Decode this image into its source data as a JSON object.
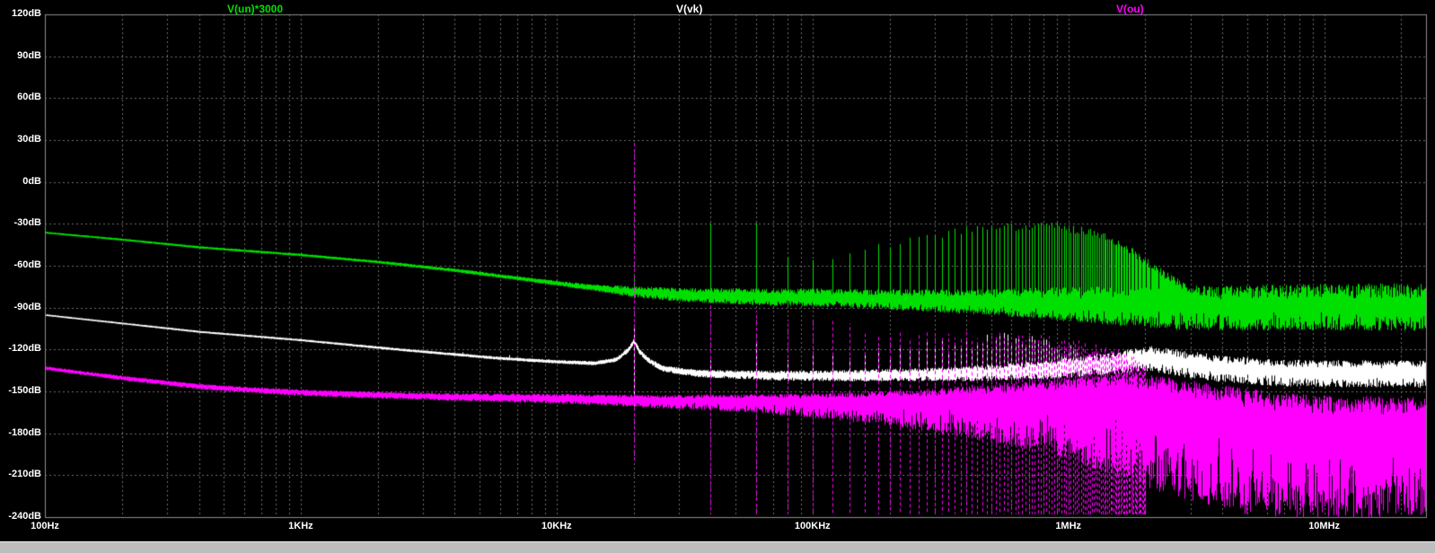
{
  "window": {
    "background": "#000000",
    "plot_border_color": "#8c8c8c",
    "grid_color": "#6f6f6f",
    "axis_text_color": "#ffffff",
    "statusbar_color": "#bdbdbd"
  },
  "chart_data": {
    "type": "line",
    "title": "",
    "grid": true,
    "legend_position": "top",
    "x_axis": {
      "scale": "log",
      "min_hz": 100,
      "max_hz": 25000000,
      "ticks": [
        "100Hz",
        "1KHz",
        "10KHz",
        "100KHz",
        "1MHz",
        "10MHz"
      ],
      "tick_hz": [
        100,
        1000,
        10000,
        100000,
        1000000,
        10000000
      ]
    },
    "y_axis": {
      "unit": "dB",
      "min": -240,
      "max": 120,
      "step": 30,
      "ticks": [
        "120dB",
        "90dB",
        "60dB",
        "30dB",
        "0dB",
        "-30dB",
        "-60dB",
        "-90dB",
        "-120dB",
        "-150dB",
        "-180dB",
        "-210dB",
        "-240dB"
      ],
      "tick_values": [
        120,
        90,
        60,
        30,
        0,
        -30,
        -60,
        -90,
        -120,
        -150,
        -180,
        -210,
        -240
      ]
    },
    "series": [
      {
        "name": "V(un)*3000",
        "color": "#00e000",
        "base": [
          [
            100,
            -36
          ],
          [
            200,
            -41
          ],
          [
            400,
            -46.5
          ],
          [
            1000,
            -52
          ],
          [
            2000,
            -57
          ],
          [
            4000,
            -63
          ],
          [
            8000,
            -70
          ],
          [
            12000,
            -74
          ],
          [
            16000,
            -76.5
          ],
          [
            20000,
            -78
          ],
          [
            30000,
            -80
          ],
          [
            60000,
            -81.5
          ],
          [
            100000,
            -82
          ],
          [
            300000,
            -84
          ],
          [
            700000,
            -85.5
          ],
          [
            1500000,
            -87
          ],
          [
            3000000,
            -88.5
          ],
          [
            25000000,
            -88
          ]
        ],
        "noise_up": [
          [
            100,
            0.4
          ],
          [
            2000,
            0.7
          ],
          [
            8000,
            1.2
          ],
          [
            14000,
            2
          ],
          [
            20000,
            3.5
          ],
          [
            50000,
            5
          ],
          [
            150000,
            6
          ],
          [
            500000,
            8
          ],
          [
            1200000,
            12
          ],
          [
            2500000,
            14
          ],
          [
            25000000,
            16
          ]
        ],
        "noise_down": [
          [
            100,
            0.4
          ],
          [
            2000,
            0.7
          ],
          [
            8000,
            1.2
          ],
          [
            14000,
            2
          ],
          [
            20000,
            4
          ],
          [
            50000,
            6
          ],
          [
            150000,
            7
          ],
          [
            500000,
            10
          ],
          [
            1200000,
            14
          ],
          [
            2500000,
            17
          ],
          [
            25000000,
            18
          ]
        ],
        "spikes": [
          {
            "f": 20000,
            "db": -66
          }
        ],
        "comb": {
          "f0": 20000,
          "n_start": 2,
          "f_max": 3200000,
          "jitter": 3,
          "env": [
            [
              40000,
              -30
            ],
            [
              60000,
              -29
            ],
            [
              80000,
              -56
            ],
            [
              100000,
              -56
            ],
            [
              140000,
              -52
            ],
            [
              200000,
              -45
            ],
            [
              300000,
              -38
            ],
            [
              500000,
              -33
            ],
            [
              900000,
              -32
            ],
            [
              1300000,
              -37
            ],
            [
              1700000,
              -48
            ],
            [
              2200000,
              -62
            ],
            [
              3200000,
              -82
            ]
          ]
        }
      },
      {
        "name": "V(vk)",
        "color": "#ffffff",
        "base": [
          [
            100,
            -95
          ],
          [
            200,
            -101
          ],
          [
            400,
            -107
          ],
          [
            1000,
            -113
          ],
          [
            2500,
            -120
          ],
          [
            6000,
            -126
          ],
          [
            10000,
            -128.5
          ],
          [
            14000,
            -129.5
          ],
          [
            17000,
            -127
          ],
          [
            19000,
            -120
          ],
          [
            20000,
            -113.5
          ],
          [
            21000,
            -121
          ],
          [
            23000,
            -128
          ],
          [
            26000,
            -133
          ],
          [
            35000,
            -136.5
          ],
          [
            55000,
            -137.5
          ],
          [
            80000,
            -138
          ],
          [
            150000,
            -138
          ],
          [
            400000,
            -136.5
          ],
          [
            800000,
            -134
          ],
          [
            1400000,
            -129
          ],
          [
            2100000,
            -125
          ],
          [
            2700000,
            -128
          ],
          [
            4000000,
            -132
          ],
          [
            7000000,
            -135
          ],
          [
            25000000,
            -136
          ]
        ],
        "noise_up": [
          [
            100,
            0.3
          ],
          [
            1000,
            0.5
          ],
          [
            6000,
            0.8
          ],
          [
            15000,
            1.2
          ],
          [
            30000,
            2
          ],
          [
            100000,
            3
          ],
          [
            300000,
            4
          ],
          [
            800000,
            6
          ],
          [
            1600000,
            7
          ],
          [
            3000000,
            8
          ],
          [
            25000000,
            8
          ]
        ],
        "noise_down": [
          [
            100,
            0.3
          ],
          [
            1000,
            0.5
          ],
          [
            6000,
            0.8
          ],
          [
            15000,
            1.2
          ],
          [
            30000,
            2.5
          ],
          [
            100000,
            4
          ],
          [
            300000,
            5
          ],
          [
            800000,
            7
          ],
          [
            1600000,
            9
          ],
          [
            3000000,
            11
          ],
          [
            25000000,
            11
          ]
        ],
        "spikes": [
          {
            "f": 4300,
            "db": -122
          },
          {
            "f": 6500,
            "db": -124
          },
          {
            "f": 40000,
            "db": -128
          },
          {
            "f": 60000,
            "db": -115
          },
          {
            "f": 20000,
            "db": -104,
            "from_db": -160
          }
        ],
        "comb": {
          "f0": 20000,
          "n_start": 4,
          "f_max": 1200000,
          "jitter": 5,
          "env": [
            [
              80000,
              -131
            ],
            [
              150000,
              -126
            ],
            [
              300000,
              -118
            ],
            [
              600000,
              -112
            ],
            [
              900000,
              -118
            ],
            [
              1200000,
              -126
            ]
          ]
        }
      },
      {
        "name": "V(ou)",
        "color": "#ff00ff",
        "base": [
          [
            100,
            -133
          ],
          [
            200,
            -140
          ],
          [
            400,
            -146
          ],
          [
            800,
            -149.5
          ],
          [
            1500,
            -151.5
          ],
          [
            4000,
            -153.5
          ],
          [
            10000,
            -154.5
          ],
          [
            25000,
            -156
          ],
          [
            80000,
            -156.5
          ],
          [
            250000,
            -155.5
          ],
          [
            600000,
            -153.5
          ],
          [
            1100000,
            -151.5
          ],
          [
            1900000,
            -153
          ],
          [
            3000000,
            -159
          ],
          [
            5000000,
            -166
          ],
          [
            9000000,
            -171
          ],
          [
            25000000,
            -173
          ]
        ],
        "noise_up": [
          [
            100,
            1
          ],
          [
            500,
            1.5
          ],
          [
            3000,
            2
          ],
          [
            15000,
            3
          ],
          [
            60000,
            4.5
          ],
          [
            200000,
            6
          ],
          [
            600000,
            9
          ],
          [
            1200000,
            13
          ],
          [
            2200000,
            16
          ],
          [
            5000000,
            18
          ],
          [
            25000000,
            19
          ]
        ],
        "noise_down": [
          [
            100,
            1
          ],
          [
            500,
            2
          ],
          [
            3000,
            2.5
          ],
          [
            15000,
            4
          ],
          [
            60000,
            8
          ],
          [
            200000,
            18
          ],
          [
            600000,
            35
          ],
          [
            1200000,
            52
          ],
          [
            2200000,
            66
          ],
          [
            5000000,
            72
          ],
          [
            25000000,
            68
          ]
        ],
        "spikes": [
          {
            "f": 20000,
            "db": 28,
            "from_db": -200,
            "dash": [
              4,
              3
            ]
          }
        ],
        "comb": {
          "f0": 20000,
          "n_start": 2,
          "f_max": 2000000,
          "jitter": 4,
          "from_db": -238,
          "dash": [
            4,
            3
          ],
          "env": [
            [
              40000,
              -86
            ],
            [
              60000,
              -89
            ],
            [
              100000,
              -100
            ],
            [
              160000,
              -106
            ],
            [
              300000,
              -110
            ],
            [
              600000,
              -112
            ],
            [
              1000000,
              -115
            ],
            [
              1600000,
              -124
            ],
            [
              2000000,
              -133
            ]
          ]
        }
      }
    ]
  }
}
